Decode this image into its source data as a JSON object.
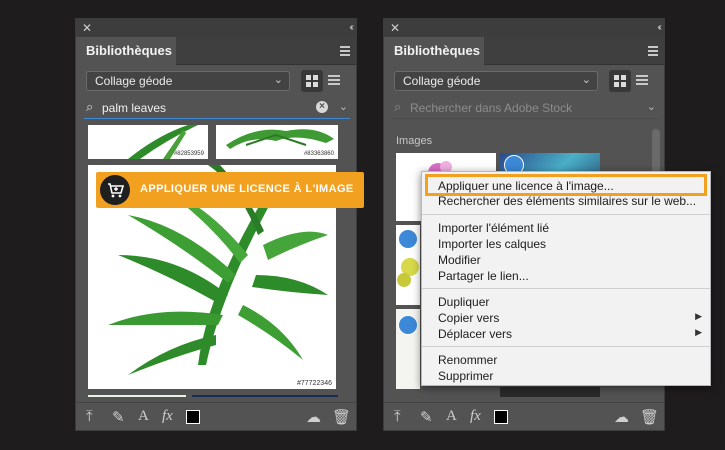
{
  "left_panel": {
    "title": "Bibliothèques",
    "library_select": "Collage géode",
    "search": {
      "value": "palm leaves",
      "placeholder": ""
    },
    "thumbs": [
      {
        "id": "#82853959"
      },
      {
        "id": "#83363860"
      },
      {
        "id": "#77722346"
      }
    ],
    "license_button": "APPLIQUER UNE LICENCE À L'IMAGE"
  },
  "right_panel": {
    "title": "Bibliothèques",
    "library_select": "Collage géode",
    "search": {
      "value": "",
      "placeholder": "Rechercher dans Adobe Stock"
    },
    "section": "Images"
  },
  "context_menu": {
    "groups": [
      [
        "Appliquer une licence à l'image...",
        "Rechercher des éléments similaires sur le web..."
      ],
      [
        "Importer l'élément lié",
        "Importer les calques",
        "Modifier",
        "Partager le lien..."
      ],
      [
        "Dupliquer",
        "Copier vers",
        "Déplacer vers"
      ],
      [
        "Renommer",
        "Supprimer"
      ]
    ]
  },
  "colors": {
    "accent": "#f2a020",
    "selection": "#3c89d8",
    "panel": "#535353",
    "background": "#1e1c1d"
  },
  "icons": [
    "close-icon",
    "collapse-icon",
    "panel-menu-icon",
    "grid-view-icon",
    "list-view-icon",
    "search-icon",
    "clear-icon",
    "chevron-down-icon",
    "cart-icon",
    "upload-icon",
    "brush-icon",
    "text-icon",
    "fx-icon",
    "color-swatch-icon",
    "creative-cloud-icon",
    "trash-icon",
    "check-icon",
    "submenu-arrow-icon"
  ]
}
